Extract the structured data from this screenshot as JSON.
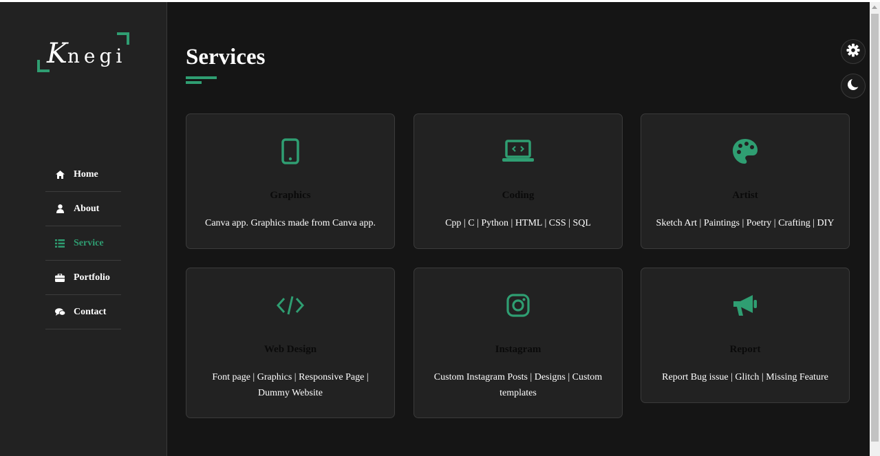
{
  "logo": {
    "initial": "K",
    "rest": "negi"
  },
  "nav": [
    {
      "label": "Home",
      "icon": "home-icon"
    },
    {
      "label": "About",
      "icon": "user-icon"
    },
    {
      "label": "Service",
      "icon": "list-icon",
      "active": true
    },
    {
      "label": "Portfolio",
      "icon": "briefcase-icon"
    },
    {
      "label": "Contact",
      "icon": "comments-icon"
    }
  ],
  "page_title": "Services",
  "services": [
    {
      "title": "Graphics",
      "desc": "Canva app. Graphics made from Canva app.",
      "icon": "mobile-icon"
    },
    {
      "title": "Coding",
      "desc": "Cpp | C | Python | HTML | CSS | SQL",
      "icon": "laptop-code-icon"
    },
    {
      "title": "Artist",
      "desc": "Sketch Art | Paintings | Poetry | Crafting | DIY",
      "icon": "palette-icon"
    },
    {
      "title": "Web Design",
      "desc": "Font page | Graphics | Responsive Page | Dummy Website",
      "icon": "code-icon"
    },
    {
      "title": "Instagram",
      "desc": "Custom Instagram Posts | Designs | Custom templates",
      "icon": "instagram-icon"
    },
    {
      "title": "Report",
      "desc": "Report Bug issue | Glitch | Missing Feature",
      "icon": "megaphone-icon"
    }
  ],
  "colors": {
    "accent": "#2f9e72",
    "sidebar": "#222222",
    "main_bg": "#151515",
    "card_bg": "#222222"
  },
  "widgets": {
    "settings_icon": "gear-icon",
    "theme_icon": "moon-icon"
  }
}
